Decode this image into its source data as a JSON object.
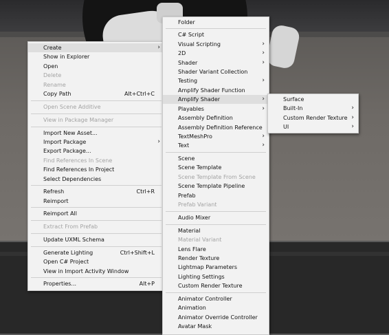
{
  "main_menu": {
    "items": [
      {
        "label": "Create",
        "has_submenu": true,
        "disabled": false,
        "highlighted": true
      },
      {
        "label": "Show in Explorer",
        "disabled": false
      },
      {
        "label": "Open",
        "disabled": false
      },
      {
        "label": "Delete",
        "disabled": true
      },
      {
        "label": "Rename",
        "disabled": true
      },
      {
        "label": "Copy Path",
        "shortcut": "Alt+Ctrl+C",
        "disabled": false
      },
      {
        "label": "Open Scene Additive",
        "disabled": true
      },
      {
        "label": "View in Package Manager",
        "disabled": true
      },
      {
        "label": "Import New Asset...",
        "disabled": false
      },
      {
        "label": "Import Package",
        "has_submenu": true,
        "disabled": false
      },
      {
        "label": "Export Package...",
        "disabled": false
      },
      {
        "label": "Find References In Scene",
        "disabled": true
      },
      {
        "label": "Find References In Project",
        "disabled": false
      },
      {
        "label": "Select Dependencies",
        "disabled": false
      },
      {
        "label": "Refresh",
        "shortcut": "Ctrl+R",
        "disabled": false
      },
      {
        "label": "Reimport",
        "disabled": false
      },
      {
        "label": "Reimport All",
        "disabled": false
      },
      {
        "label": "Extract From Prefab",
        "disabled": true
      },
      {
        "label": "Update UXML Schema",
        "disabled": false
      },
      {
        "label": "Generate Lighting",
        "shortcut": "Ctrl+Shift+L",
        "disabled": false
      },
      {
        "label": "Open C# Project",
        "disabled": false
      },
      {
        "label": "View in Import Activity Window",
        "disabled": false
      },
      {
        "label": "Properties...",
        "shortcut": "Alt+P",
        "disabled": false
      }
    ]
  },
  "create_menu": {
    "items": [
      {
        "label": "Folder",
        "disabled": false
      },
      {
        "label": "C# Script",
        "disabled": false
      },
      {
        "label": "Visual Scripting",
        "has_submenu": true,
        "disabled": false
      },
      {
        "label": "2D",
        "has_submenu": true,
        "disabled": false
      },
      {
        "label": "Shader",
        "has_submenu": true,
        "disabled": false
      },
      {
        "label": "Shader Variant Collection",
        "disabled": false
      },
      {
        "label": "Testing",
        "has_submenu": true,
        "disabled": false
      },
      {
        "label": "Amplify Shader Function",
        "disabled": false
      },
      {
        "label": "Amplify Shader",
        "has_submenu": true,
        "disabled": false,
        "highlighted": true
      },
      {
        "label": "Playables",
        "has_submenu": true,
        "disabled": false
      },
      {
        "label": "Assembly Definition",
        "disabled": false
      },
      {
        "label": "Assembly Definition Reference",
        "disabled": false
      },
      {
        "label": "TextMeshPro",
        "has_submenu": true,
        "disabled": false
      },
      {
        "label": "Text",
        "has_submenu": true,
        "disabled": false
      },
      {
        "label": "Scene",
        "disabled": false
      },
      {
        "label": "Scene Template",
        "disabled": false
      },
      {
        "label": "Scene Template From Scene",
        "disabled": true
      },
      {
        "label": "Scene Template Pipeline",
        "disabled": false
      },
      {
        "label": "Prefab",
        "disabled": false
      },
      {
        "label": "Prefab Variant",
        "disabled": true
      },
      {
        "label": "Audio Mixer",
        "disabled": false
      },
      {
        "label": "Material",
        "disabled": false
      },
      {
        "label": "Material Variant",
        "disabled": true
      },
      {
        "label": "Lens Flare",
        "disabled": false
      },
      {
        "label": "Render Texture",
        "disabled": false
      },
      {
        "label": "Lightmap Parameters",
        "disabled": false
      },
      {
        "label": "Lighting Settings",
        "disabled": false
      },
      {
        "label": "Custom Render Texture",
        "disabled": false
      },
      {
        "label": "Animator Controller",
        "disabled": false
      },
      {
        "label": "Animation",
        "disabled": false
      },
      {
        "label": "Animator Override Controller",
        "disabled": false
      },
      {
        "label": "Avatar Mask",
        "disabled": false
      }
    ]
  },
  "amplify_menu": {
    "items": [
      {
        "label": "Surface",
        "disabled": false
      },
      {
        "label": "Built-In",
        "has_submenu": true,
        "disabled": false
      },
      {
        "label": "Custom Render Texture",
        "has_submenu": true,
        "disabled": false
      },
      {
        "label": "UI",
        "has_submenu": true,
        "disabled": false
      }
    ]
  },
  "arrow_glyph": "›"
}
